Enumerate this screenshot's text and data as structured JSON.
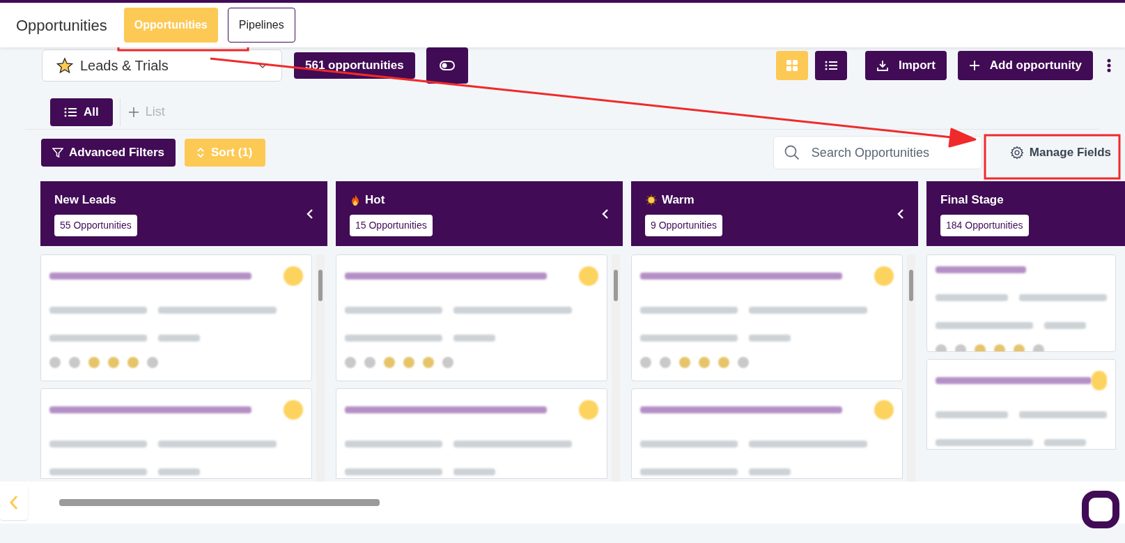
{
  "header": {
    "title": "Opportunities",
    "tabs": [
      {
        "label": "Opportunities",
        "selected": true
      },
      {
        "label": "Pipelines",
        "selected": false
      }
    ]
  },
  "toolbar": {
    "pipeline_select": {
      "value": "Leads & Trials"
    },
    "count_badge": "561 opportunities",
    "views": [
      {
        "kind": "grid",
        "selected": true
      },
      {
        "kind": "list",
        "selected": false
      }
    ],
    "import_button": "Import",
    "add_button": "Add opportunity"
  },
  "lists": {
    "tabs": [
      {
        "label": "All",
        "selected": true
      }
    ],
    "add_list": "List"
  },
  "filters": {
    "advanced_filters": "Advanced Filters",
    "sort": "Sort (1)",
    "search": {
      "placeholder": "Search Opportunities"
    },
    "manage_fields": "Manage Fields"
  },
  "stages": [
    {
      "title": "New Leads",
      "kind": "plain",
      "count": "55 Opportunities",
      "collapsible": true,
      "cards": [
        {
          "kind": "with_icons"
        },
        {
          "kind": "cut_off"
        }
      ]
    },
    {
      "title": "Hot",
      "kind": "fire",
      "count": "15 Opportunities",
      "collapsible": true,
      "cards": [
        {
          "kind": "with_icons"
        },
        {
          "kind": "cut_off"
        }
      ]
    },
    {
      "title": "Warm",
      "kind": "sun",
      "count": "9 Opportunities",
      "collapsible": true,
      "cards": [
        {
          "kind": "with_icons"
        },
        {
          "kind": "cut_off"
        }
      ]
    },
    {
      "title": "Final Stage",
      "kind": "plain",
      "count": "184 Opportunities",
      "cards": [
        {
          "kind": "short"
        },
        {
          "kind": "cut_off"
        }
      ]
    }
  ]
}
